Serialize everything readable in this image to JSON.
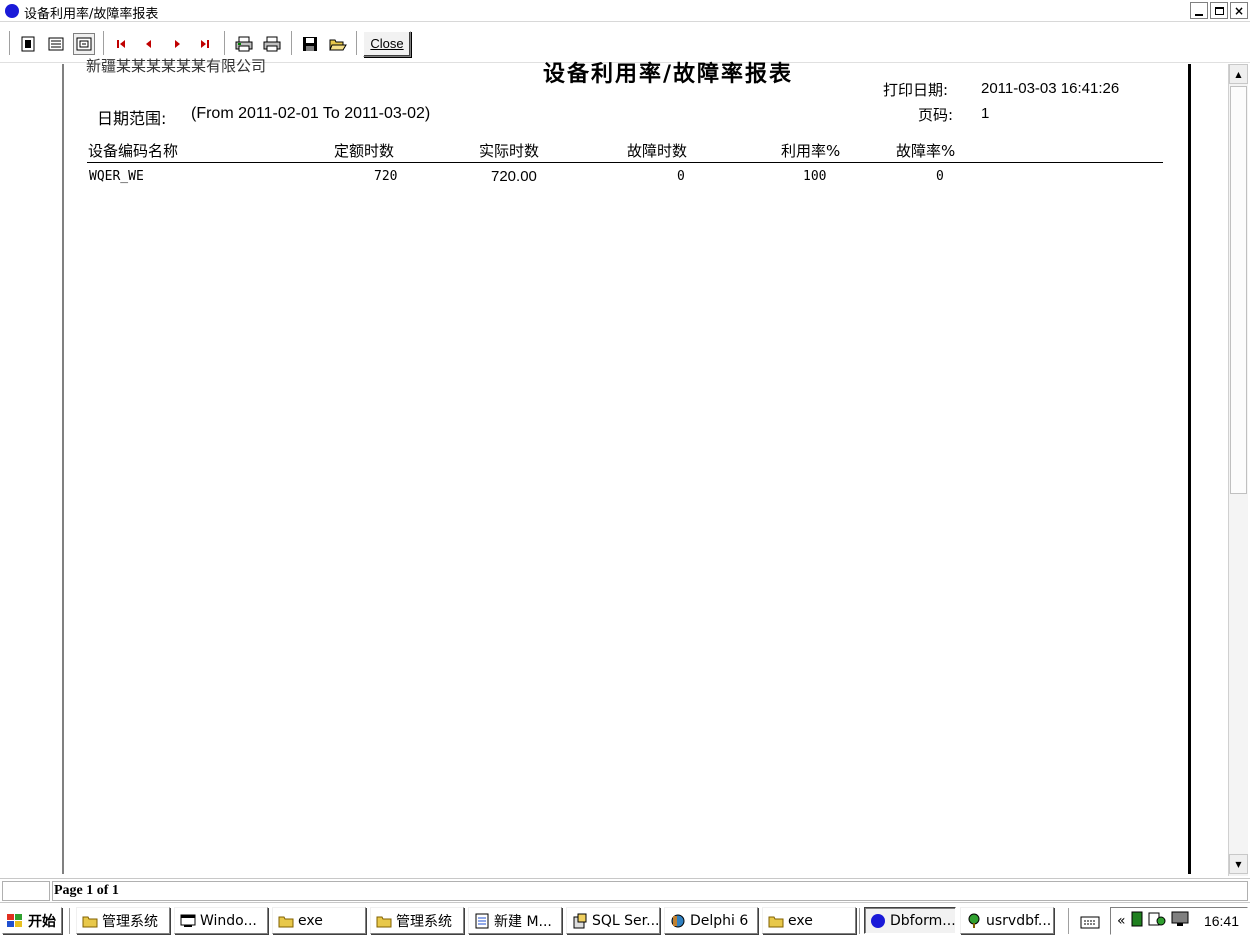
{
  "window": {
    "title": "设备利用率/故障率报表",
    "controls": {
      "minimize": "_",
      "restore": "❐",
      "close": "×"
    }
  },
  "toolbar": {
    "buttons": [
      {
        "icon": "zoom-fit-icon"
      },
      {
        "icon": "page-width-icon"
      },
      {
        "icon": "zoom-100-icon",
        "pressed": true
      },
      {
        "icon": "first-page-icon"
      },
      {
        "icon": "prev-page-icon"
      },
      {
        "icon": "next-page-icon"
      },
      {
        "icon": "last-page-icon"
      },
      {
        "icon": "printer-setup-icon"
      },
      {
        "icon": "printer-icon"
      },
      {
        "icon": "save-icon"
      },
      {
        "icon": "open-folder-icon"
      }
    ],
    "close_label": "Close"
  },
  "report": {
    "company": "新疆某某某某某某有限公司",
    "title": "设备利用率/故障率报表",
    "print_date_label": "打印日期:",
    "print_date_value": "2011-03-03 16:41:26",
    "date_range_label": "日期范围:",
    "date_range_value": "(From 2011-02-01 To 2011-03-02)",
    "page_label": "页码:",
    "page_value": "1",
    "columns": [
      "设备编码名称",
      "定额时数",
      "实际时数",
      "故障时数",
      "利用率%",
      "故障率%"
    ],
    "rows": [
      [
        "WQER_WE",
        "720",
        "720.00",
        "0",
        "100",
        "0"
      ]
    ]
  },
  "statusbar": {
    "page_info": "Page 1 of 1"
  },
  "taskbar": {
    "start_label": "开始",
    "tasks": [
      {
        "label": "管理系统",
        "icon": "folder-icon"
      },
      {
        "label": "Windo...",
        "icon": "window-icon"
      },
      {
        "label": "exe",
        "icon": "folder-icon"
      },
      {
        "label": "管理系统",
        "icon": "folder-icon"
      },
      {
        "label": "新建 M...",
        "icon": "word-doc-icon"
      },
      {
        "label": "SQL Ser...",
        "icon": "sql-server-icon"
      },
      {
        "label": "Delphi 6",
        "icon": "delphi-icon"
      },
      {
        "label": "exe",
        "icon": "folder-icon"
      },
      {
        "label": "Dbform...",
        "icon": "app-dot-icon",
        "active": true
      },
      {
        "label": "usrvdbf...",
        "icon": "tree-icon"
      }
    ],
    "clock": "16:41",
    "tray_expand": "«"
  },
  "colors": {
    "app_dot": "#1a1ad8",
    "nav_arrow": "#c00000",
    "folder": "#e8c84a"
  }
}
